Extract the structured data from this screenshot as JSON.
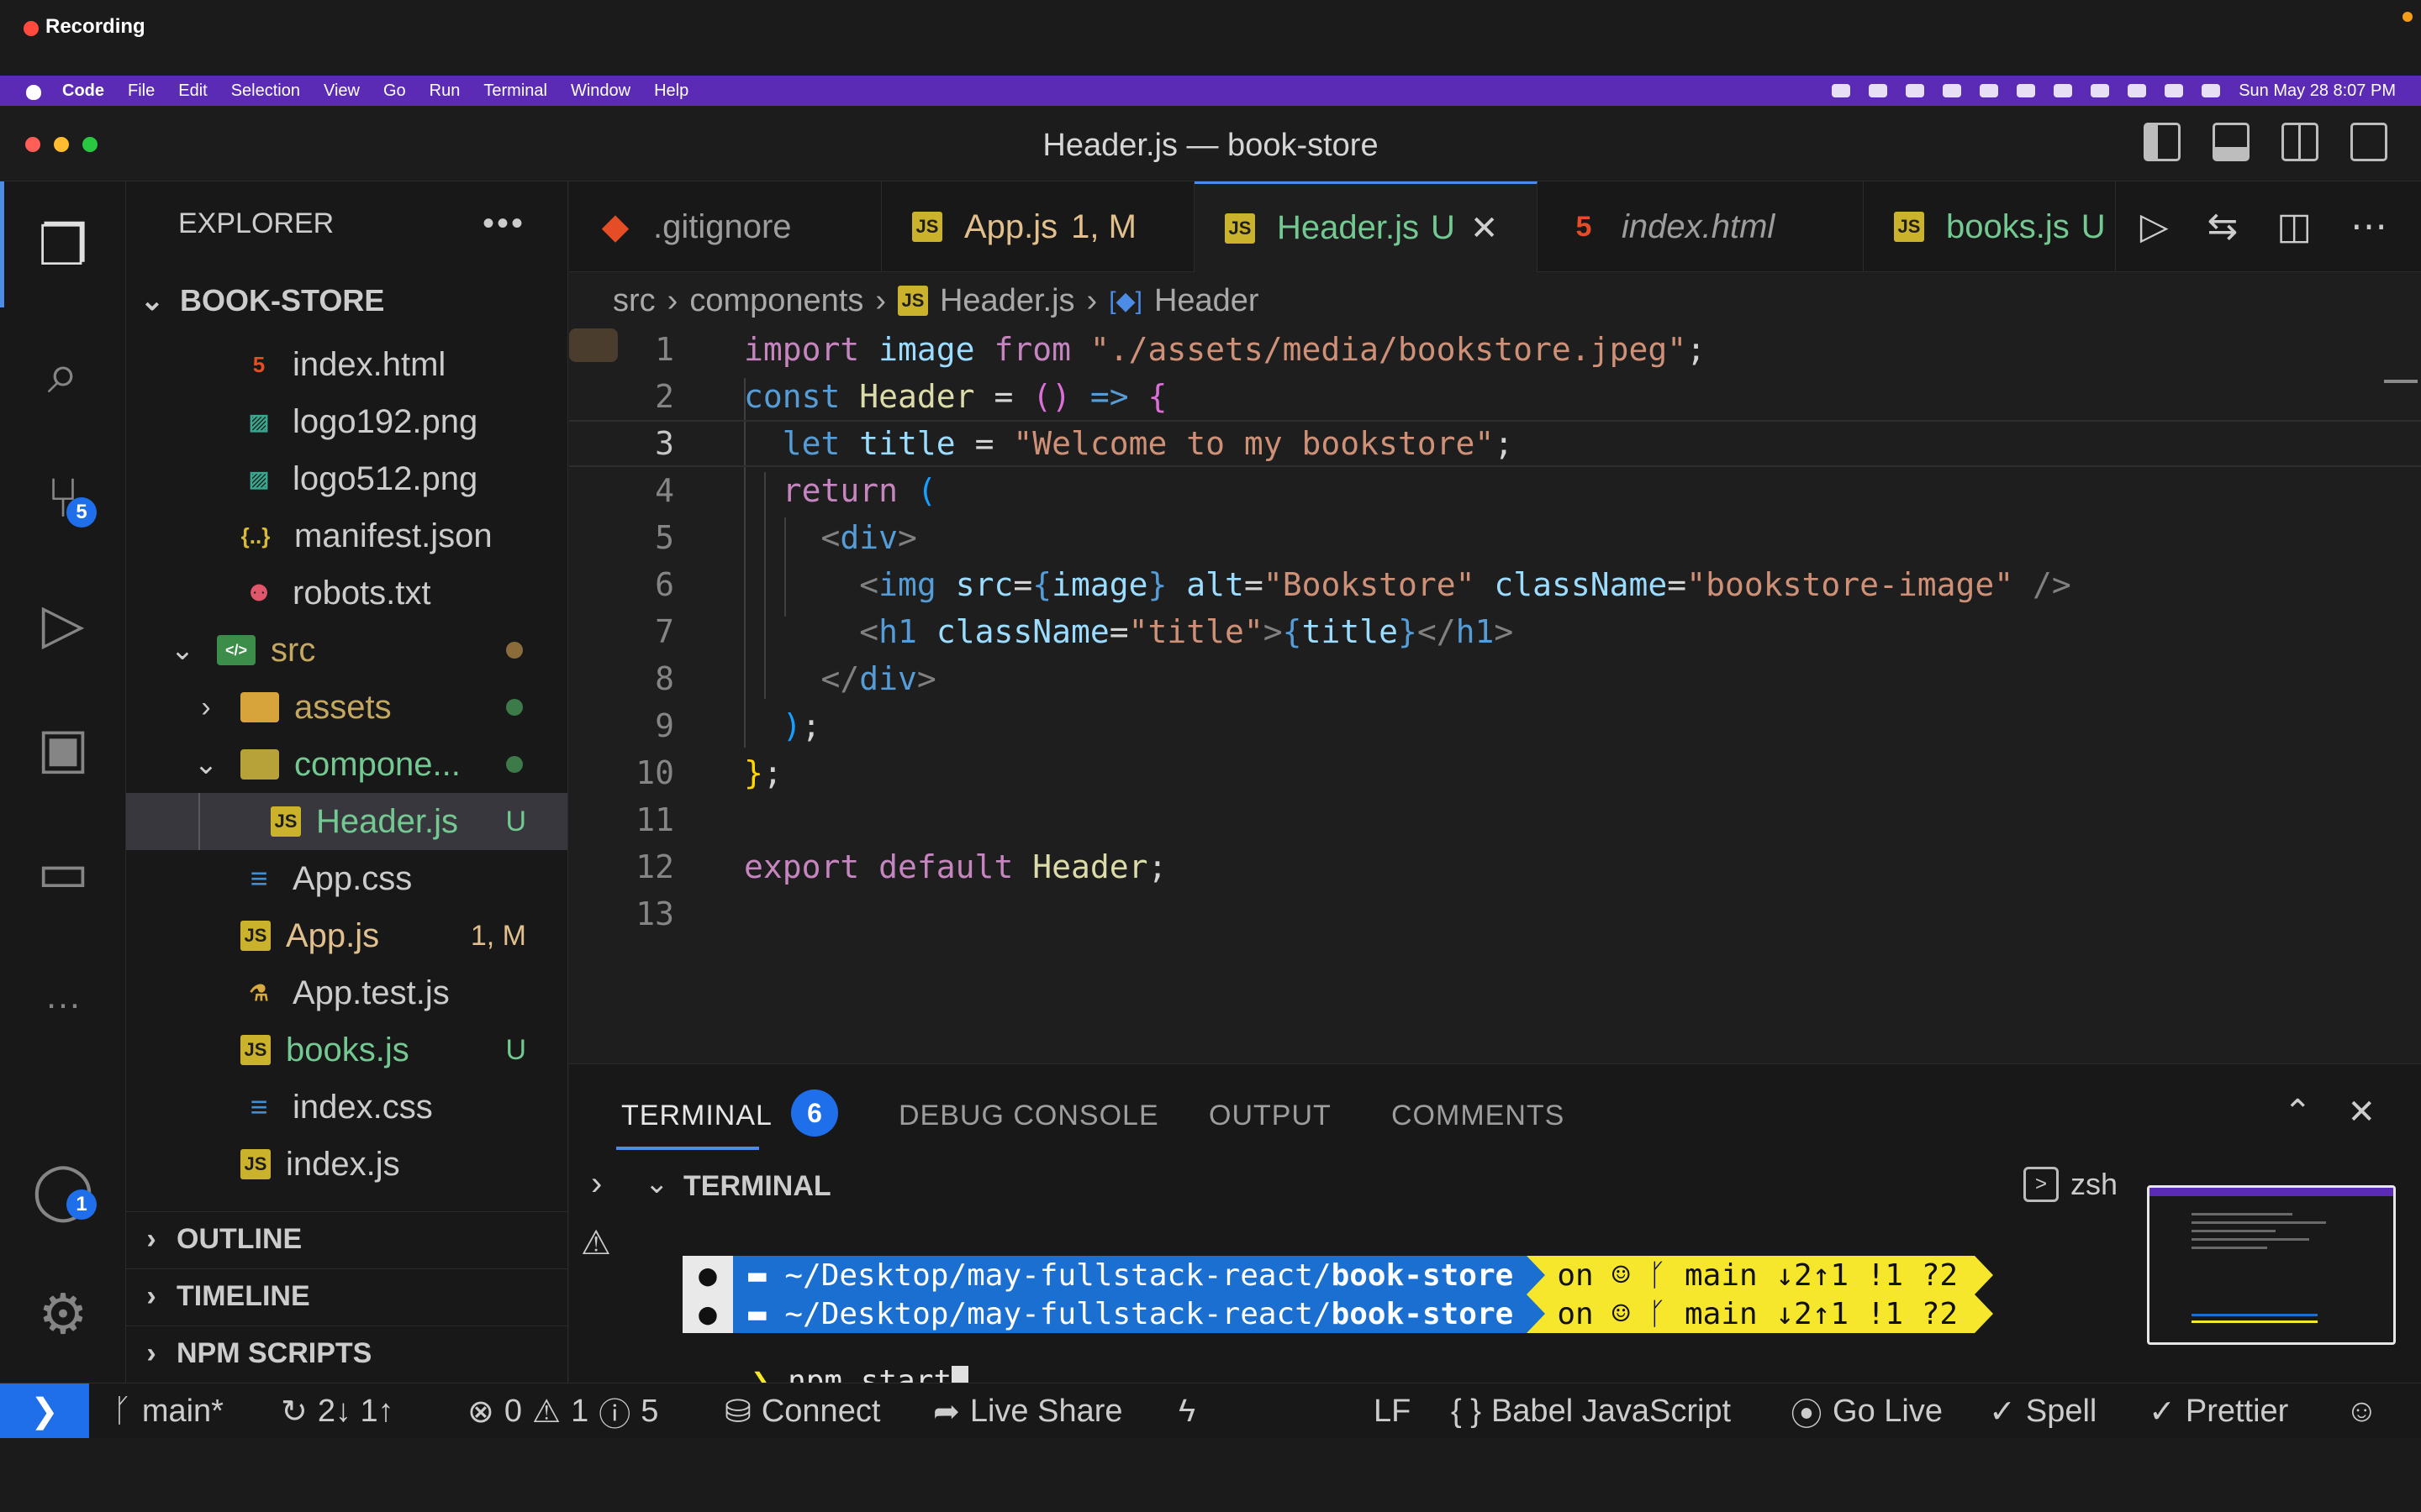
{
  "recording": {
    "label": "Recording"
  },
  "menubar": {
    "items": [
      "Code",
      "File",
      "Edit",
      "Selection",
      "View",
      "Go",
      "Run",
      "Terminal",
      "Window",
      "Help"
    ],
    "clock": "Sun May 28  8:07 PM"
  },
  "window": {
    "title": "Header.js — book-store"
  },
  "activity": {
    "source_control_badge": "5",
    "accounts_badge": "1"
  },
  "explorer": {
    "title": "EXPLORER",
    "root": "BOOK-STORE",
    "items": [
      {
        "label": "index.html",
        "icon": "html-icon",
        "color": "#cccccc"
      },
      {
        "label": "logo192.png",
        "icon": "image-icon",
        "color": "#cccccc"
      },
      {
        "label": "logo512.png",
        "icon": "image-icon",
        "color": "#cccccc"
      },
      {
        "label": "manifest.json",
        "icon": "json-icon",
        "color": "#cccccc"
      },
      {
        "label": "robots.txt",
        "icon": "robot-icon",
        "color": "#cccccc"
      },
      {
        "label": "src",
        "icon": "folder-src-icon",
        "color": "#c5a85f"
      },
      {
        "label": "assets",
        "icon": "folder-icon",
        "color": "#c5a85f"
      },
      {
        "label": "compone...",
        "icon": "folder-icon",
        "color": "#c5a85f"
      },
      {
        "label": "Header.js",
        "icon": "js-icon",
        "color": "#73c991",
        "deco": "U"
      },
      {
        "label": "App.css",
        "icon": "css-icon",
        "color": "#cccccc"
      },
      {
        "label": "App.js",
        "icon": "js-icon",
        "color": "#e2c08d",
        "deco": "1, M"
      },
      {
        "label": "App.test.js",
        "icon": "test-icon",
        "color": "#cccccc"
      },
      {
        "label": "books.js",
        "icon": "js-icon",
        "color": "#73c991",
        "deco": "U"
      },
      {
        "label": "index.css",
        "icon": "css-icon",
        "color": "#cccccc"
      },
      {
        "label": "index.js",
        "icon": "js-icon",
        "color": "#cccccc"
      }
    ],
    "sections": [
      "OUTLINE",
      "TIMELINE",
      "NPM SCRIPTS"
    ]
  },
  "tabs": [
    {
      "label": ".gitignore",
      "deco": "",
      "color": "#9d9d9d"
    },
    {
      "label": "App.js",
      "deco": "1, M",
      "color": "#e2c08d"
    },
    {
      "label": "Header.js",
      "deco": "U",
      "color": "#73c991"
    },
    {
      "label": "index.html",
      "deco": "",
      "color": "#9d9d9d"
    },
    {
      "label": "books.js",
      "deco": "U",
      "color": "#73c991"
    }
  ],
  "breadcrumb": [
    "src",
    "components",
    "Header.js",
    "Header"
  ],
  "code": {
    "line_numbers": [
      "1",
      "2",
      "3",
      "4",
      "5",
      "6",
      "7",
      "8",
      "9",
      "10",
      "11",
      "12",
      "13"
    ],
    "import_path": "\"./assets/media/bookstore.jpeg\"",
    "title_string": "\"Welcome to my bookstore\"",
    "alt_string": "\"Bookstore\"",
    "class_string": "\"bookstore-image\"",
    "h1_class": "\"title\""
  },
  "panel": {
    "tabs": [
      "TERMINAL",
      "DEBUG CONSOLE",
      "OUTPUT",
      "COMMENTS"
    ],
    "terminal_badge": "6",
    "terminal_label": "TERMINAL",
    "shell": "zsh",
    "prompt_path_prefix": "~/Desktop/may-fullstack-react/",
    "prompt_path_dir": "book-store",
    "prompt_git": "on ☺ ᚴ main ↓2↑1 !1 ?2",
    "command": "npm start"
  },
  "statusbar": {
    "branch": "main*",
    "sync": "2↓ 1↑",
    "errors": "0",
    "warnings": "1",
    "infos": "5",
    "connect": "Connect",
    "liveshare": "Live Share",
    "eol": "LF",
    "language": "Babel JavaScript",
    "golive": "Go Live",
    "spell": "Spell",
    "prettier": "Prettier"
  }
}
